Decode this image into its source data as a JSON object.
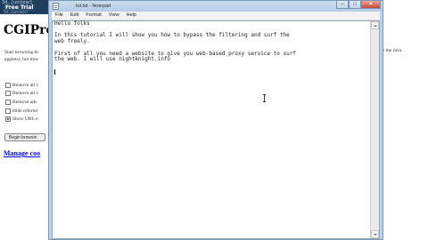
{
  "background_page": {
    "top_strip_text": "3d...[unclear]",
    "free_trial_badge": "Free Trial",
    "free_trial_sub": "3d...[unclear]",
    "title": "CGIPro",
    "intro_line1": "Start browsing th",
    "intro_line2": "applets), but mos",
    "intro_right1": "ve the Java",
    "intro_right2": "",
    "options": [
      {
        "label": "Remove all c",
        "checked": false
      },
      {
        "label": "Remove all s",
        "checked": false
      },
      {
        "label": "Remove ads",
        "checked": false
      },
      {
        "label": "Hide referrer",
        "checked": false
      },
      {
        "label": "Show URL e",
        "checked": true
      }
    ],
    "begin_button": "Begin browsin",
    "manage_link": "Manage coo"
  },
  "notepad": {
    "title": "tut.txt - Notepad",
    "menu": [
      "File",
      "Edit",
      "Format",
      "View",
      "Help"
    ],
    "buttons": {
      "minimize": "–",
      "maximize": "□",
      "close": "×"
    },
    "content": "Hello folks\n\nIn this tutorial I will show you how to bypass the filtering and surf the\nweb freely.\n\nFirst of all you need a website to give you web-based proxy service to surf\nthe web. I will use nightknight.info",
    "colors": {
      "frame": "#b9d1ea",
      "close": "#c7493a",
      "text": "#222222"
    }
  }
}
